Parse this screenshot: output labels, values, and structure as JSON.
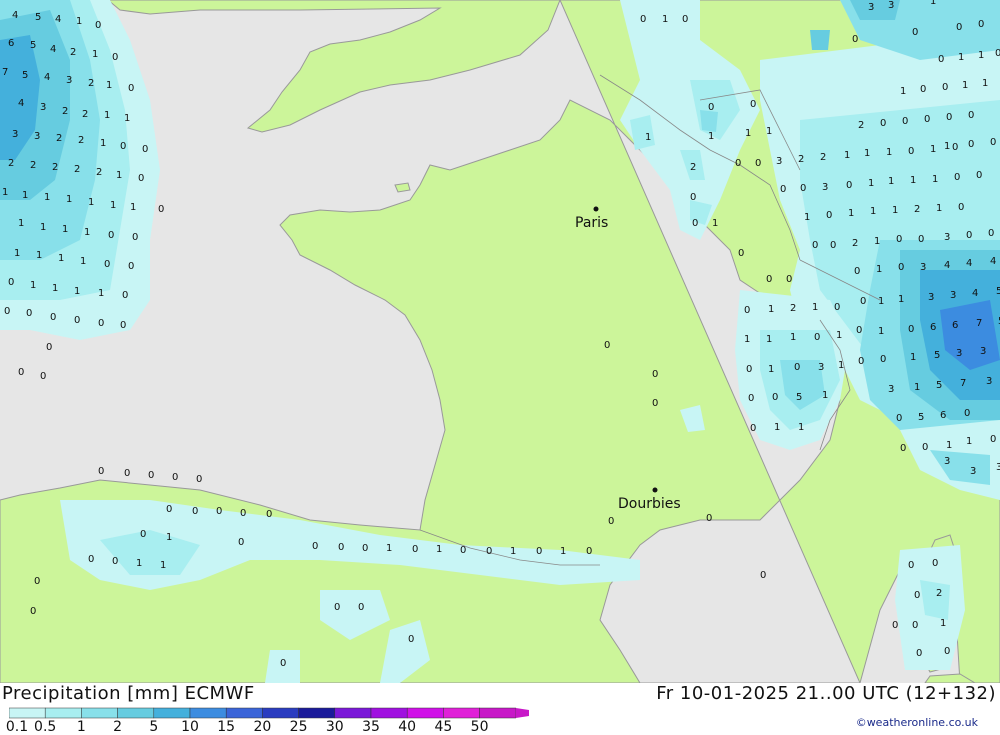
{
  "header": {
    "title": "Precipitation [mm] ECMWF",
    "valid_time": "Fr 10-01-2025 21..00 UTC (12+132)",
    "credit": "©weatheronline.co.uk"
  },
  "colors": {
    "sea": "#e6e6e6",
    "land": "#ccf59a",
    "coast": "#999999"
  },
  "cities": [
    {
      "name": "Paris"
    },
    {
      "name": "Dourbies"
    }
  ],
  "legend": {
    "labels": [
      "0.1",
      "0.5",
      "1",
      "2",
      "5",
      "10",
      "15",
      "20",
      "25",
      "30",
      "35",
      "40",
      "45",
      "50"
    ],
    "colors": [
      "#c8f5f5",
      "#a8eef0",
      "#88e0ea",
      "#66cce0",
      "#44b0dc",
      "#3c8ce0",
      "#3a64d8",
      "#2a3cc0",
      "#1a1a9a",
      "#7a18d8",
      "#a010e0",
      "#d010e8",
      "#e020d8",
      "#c818c8"
    ]
  },
  "grid_values": [
    "0",
    "0.1",
    "1",
    "2",
    "3",
    "4",
    "5",
    "6",
    "7"
  ]
}
